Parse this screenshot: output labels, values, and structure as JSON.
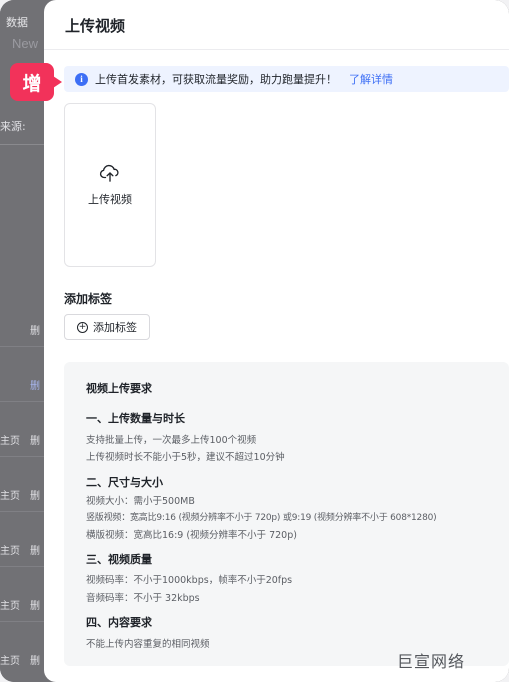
{
  "background": {
    "top_label": "数据",
    "new_label": "New",
    "source_label": "来源:",
    "rows": [
      {
        "a": "",
        "b": "删"
      },
      {
        "a": "",
        "b": "删"
      },
      {
        "a": "主页",
        "b": "删"
      },
      {
        "a": "主页",
        "b": "删"
      },
      {
        "a": "主页",
        "b": "删"
      },
      {
        "a": "主页",
        "b": "删"
      },
      {
        "a": "主页",
        "b": "删"
      }
    ]
  },
  "badge": {
    "label": "增"
  },
  "drawer": {
    "title": "上传视频",
    "notice": {
      "icon": "info-icon",
      "text": "上传首发素材，可获取流量奖励，助力跑量提升！",
      "link": "了解详情"
    },
    "upload": {
      "icon": "cloud-upload-icon",
      "label": "上传视频"
    },
    "tags": {
      "title": "添加标签",
      "button_label": "添加标签"
    },
    "requirements": {
      "title": "视频上传要求",
      "sections": [
        {
          "heading": "一、上传数量与时长",
          "lines": [
            "支持批量上传，一次最多上传100个视频",
            "上传视频时长不能小于5秒，建议不超过10分钟"
          ]
        },
        {
          "heading": "二、尺寸与大小",
          "lines": [
            "视频大小：需小于500MB",
            "竖版视频：宽高比9:16 (视频分辨率不小于 720p) 或9:19 (视频分辨率不小于 608*1280)",
            "横版视频：宽高比16:9 (视频分辨率不小于 720p)"
          ]
        },
        {
          "heading": "三、视频质量",
          "lines": [
            "视频码率：不小于1000kbps，帧率不小于20fps",
            "音频码率：不小于 32kbps"
          ]
        },
        {
          "heading": "四、内容要求",
          "lines": [
            "不能上传内容重复的相同视频"
          ]
        }
      ]
    }
  },
  "watermark": "巨宣网络",
  "colors": {
    "accent": "#3d6ff5",
    "badge": "#f2325a",
    "notice_bg": "#eef3ff"
  }
}
